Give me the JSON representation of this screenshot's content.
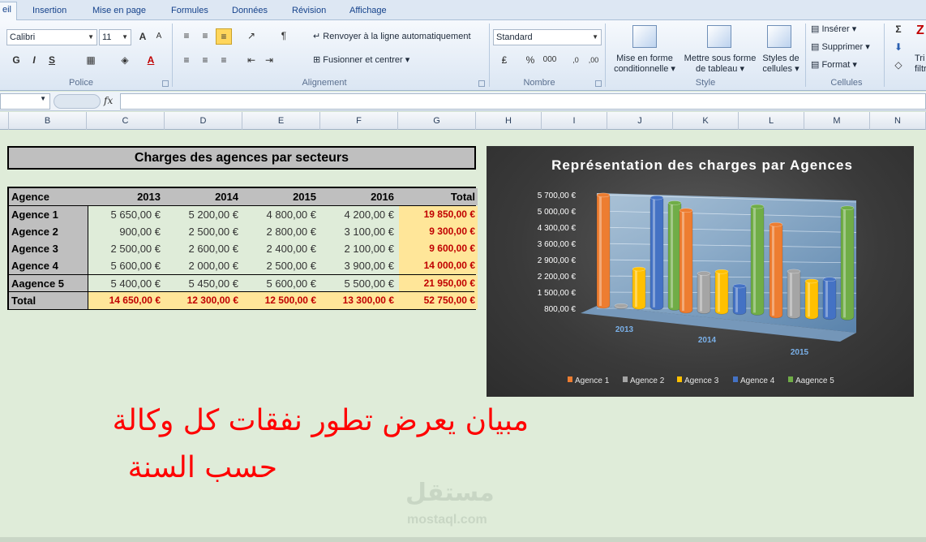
{
  "ribbon": {
    "tabs": [
      "eil",
      "Insertion",
      "Mise en page",
      "Formules",
      "Données",
      "Révision",
      "Affichage"
    ],
    "font_name": "Calibri",
    "font_size": "11",
    "wrap_text": "Renvoyer à la ligne automatiquement",
    "merge_center": "Fusionner et centrer",
    "number_format": "Standard",
    "cond_format": [
      "Mise en forme",
      "conditionnelle"
    ],
    "format_table": [
      "Mettre sous forme",
      "de tableau"
    ],
    "cell_styles": [
      "Styles de",
      "cellules"
    ],
    "insert": "Insérer",
    "delete": "Supprimer",
    "format": "Format",
    "bold": "G",
    "italic": "I",
    "underline": "S",
    "sort_cut": [
      "Tri",
      "filtr"
    ],
    "groups": {
      "font": "Police",
      "alignment": "Alignement",
      "number": "Nombre",
      "style": "Style",
      "cells": "Cellules"
    }
  },
  "formula_bar": {
    "fx": "fx",
    "value": ""
  },
  "columns": [
    "B",
    "C",
    "D",
    "E",
    "F",
    "G",
    "H",
    "I",
    "J",
    "K",
    "L",
    "M",
    "N"
  ],
  "table": {
    "title": "Charges des agences par secteurs",
    "headers": [
      "Agence",
      "2013",
      "2014",
      "2015",
      "2016",
      "Total"
    ],
    "rows": [
      {
        "label": "Agence 1",
        "values": [
          "5 650,00 €",
          "5 200,00 €",
          "4 800,00 €",
          "4 200,00 €"
        ],
        "total": "19 850,00 €"
      },
      {
        "label": "Agence 2",
        "values": [
          "900,00 €",
          "2 500,00 €",
          "2 800,00 €",
          "3 100,00 €"
        ],
        "total": "9 300,00 €"
      },
      {
        "label": "Agence 3",
        "values": [
          "2 500,00 €",
          "2 600,00 €",
          "2 400,00 €",
          "2 100,00 €"
        ],
        "total": "9 600,00 €"
      },
      {
        "label": "Agence 4",
        "values": [
          "5 600,00 €",
          "2 000,00 €",
          "2 500,00 €",
          "3 900,00 €"
        ],
        "total": "14 000,00 €"
      },
      {
        "label": "Aagence 5",
        "values": [
          "5 400,00 €",
          "5 450,00 €",
          "5 600,00 €",
          "5 500,00 €"
        ],
        "total": "21 950,00 €"
      }
    ],
    "total_row": {
      "label": "Total",
      "values": [
        "14 650,00 €",
        "12 300,00 €",
        "12 500,00 €",
        "13 300,00 €"
      ],
      "total": "52 750,00 €"
    }
  },
  "chart_data": {
    "type": "bar",
    "title": "Représentation des charges par Agences",
    "categories": [
      "2013",
      "2014",
      "2015"
    ],
    "y_ticks": [
      "800,00 €",
      "1 500,00 €",
      "2 200,00 €",
      "2 900,00 €",
      "3 600,00 €",
      "4 300,00 €",
      "5 000,00 €",
      "5 700,00 €"
    ],
    "ylim": [
      800,
      5700
    ],
    "series": [
      {
        "name": "Agence 1",
        "values": [
          5650,
          5200,
          4800
        ],
        "color": "#ed7d31"
      },
      {
        "name": "Agence 2",
        "values": [
          900,
          2500,
          2800
        ],
        "color": "#a5a5a5"
      },
      {
        "name": "Agence 3",
        "values": [
          2500,
          2600,
          2400
        ],
        "color": "#ffc000"
      },
      {
        "name": "Agence 4",
        "values": [
          5600,
          2000,
          2500
        ],
        "color": "#4472c4"
      },
      {
        "name": "Aagence 5",
        "values": [
          5400,
          5450,
          5600
        ],
        "color": "#70ad47"
      }
    ],
    "legend": "bottom"
  },
  "annotation": {
    "line1": "مبيان يعرض تطور نفقات كل وكالة",
    "line2": "حسب السنة",
    "color": "#ff0000"
  },
  "watermark": {
    "arabic": "مستقل",
    "latin": "mostaql.com"
  }
}
